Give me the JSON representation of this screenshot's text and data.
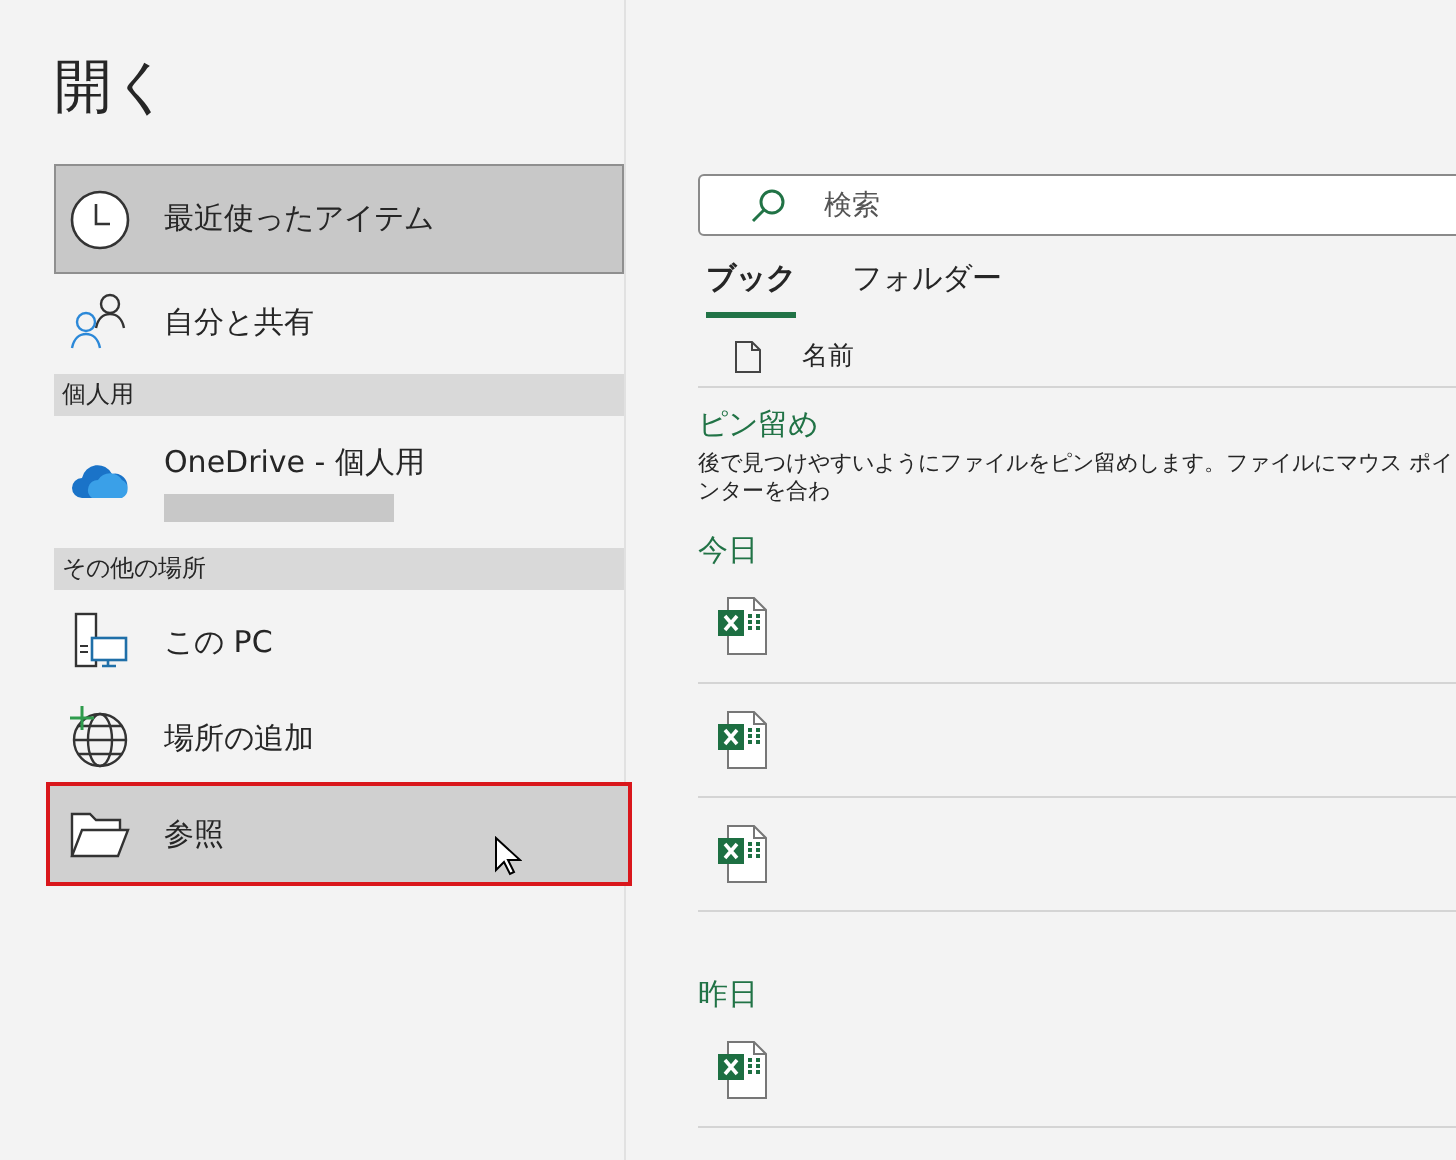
{
  "title": "開く",
  "nav": [
    {
      "kind": "item",
      "label": "最近使ったアイテム",
      "selected": true,
      "highlighted": false
    },
    {
      "kind": "item",
      "label": "自分と共有",
      "selected": false,
      "highlighted": false
    },
    {
      "kind": "header",
      "label": "個人用"
    },
    {
      "kind": "item",
      "label": "OneDrive - 個人用",
      "selected": false,
      "highlighted": false,
      "account_hidden": true
    },
    {
      "kind": "header",
      "label": "その他の場所"
    },
    {
      "kind": "item",
      "label": "この PC",
      "selected": false,
      "highlighted": false
    },
    {
      "kind": "item",
      "label": "場所の追加",
      "selected": false,
      "highlighted": false
    },
    {
      "kind": "item",
      "label": "参照",
      "selected": false,
      "highlighted": true
    }
  ],
  "search": {
    "placeholder": "検索"
  },
  "tabs": [
    {
      "label": "ブック",
      "selected": true
    },
    {
      "label": "フォルダー",
      "selected": false
    }
  ],
  "column": "名前",
  "groups": [
    {
      "title": "ピン留め",
      "description": "後で見つけやすいようにファイルをピン留めします。ファイルにマウス ポインターを合わ"
    },
    {
      "title": "今日",
      "files": [
        {
          "kind": "workbook"
        },
        {
          "kind": "workbook"
        },
        {
          "kind": "workbook"
        }
      ]
    },
    {
      "title": "昨日",
      "files": [
        {
          "kind": "workbook"
        }
      ]
    }
  ]
}
